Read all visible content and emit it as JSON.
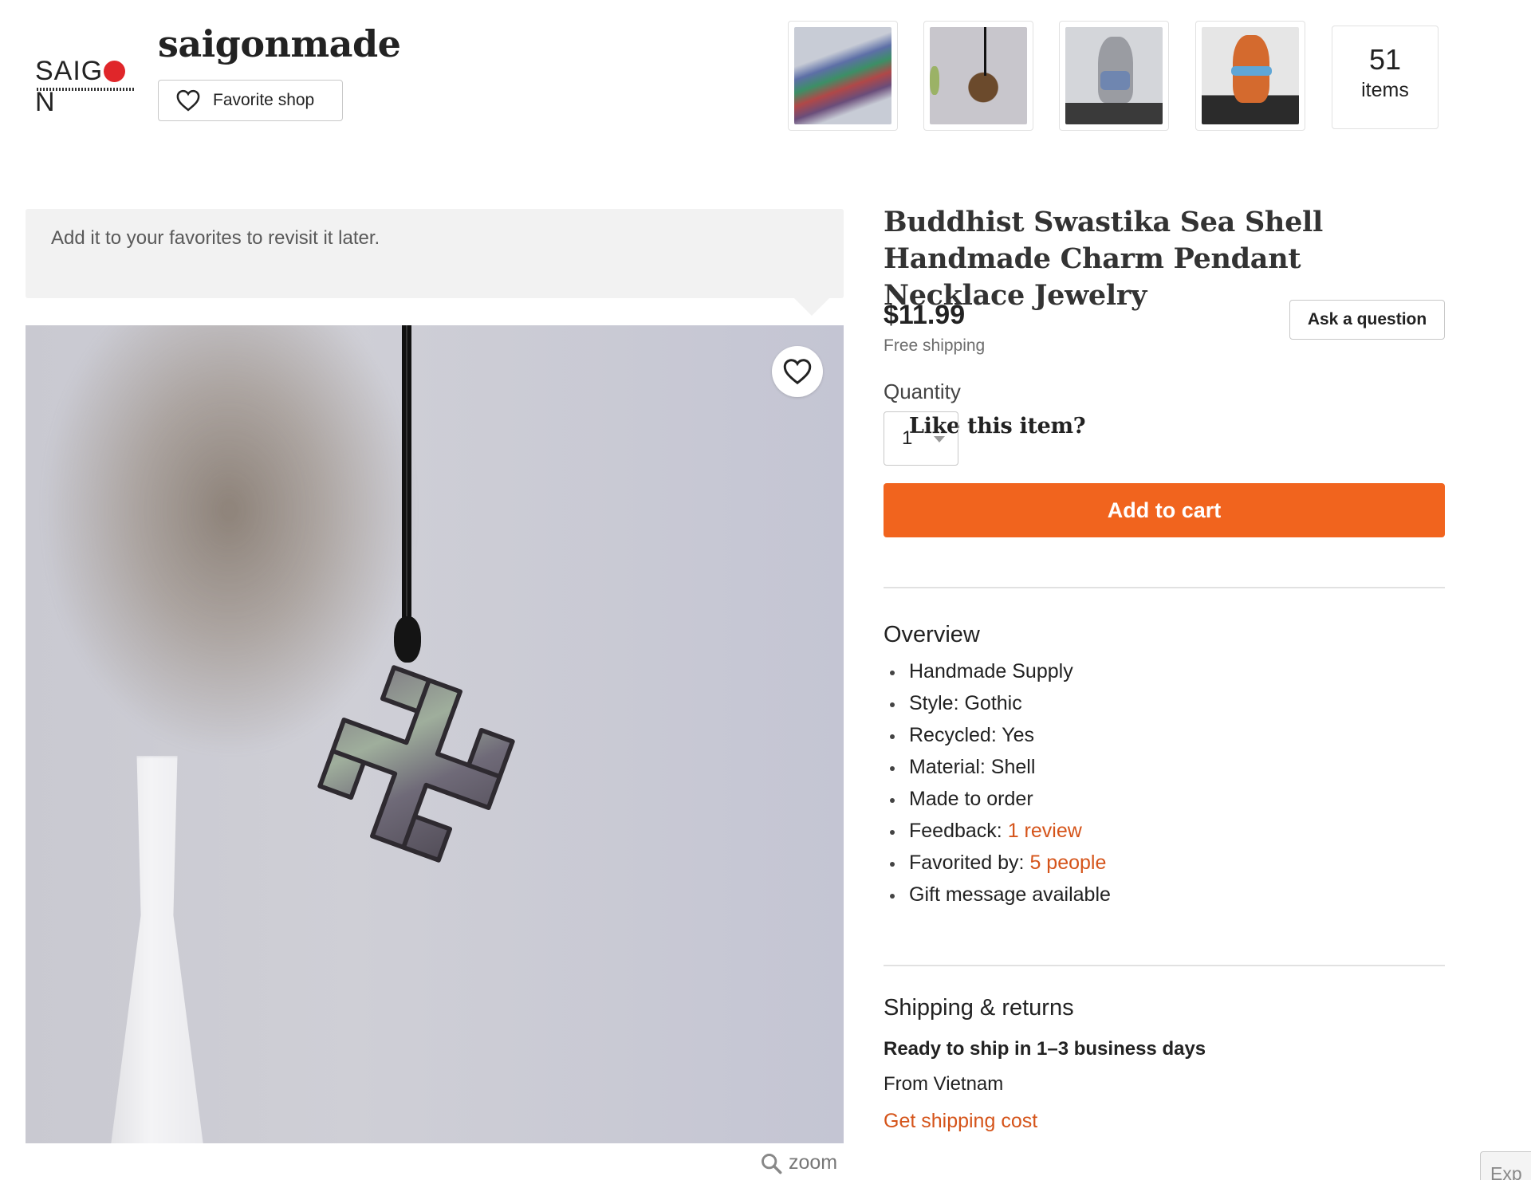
{
  "shop": {
    "logo_text_left": "SAIG",
    "logo_text_right": "N",
    "name": "saigonmade",
    "favorite_label": "Favorite shop",
    "items_count": "51",
    "items_label": "items"
  },
  "banner": {
    "title": "Like this item?",
    "subtitle": "Add it to your favorites to revisit it later."
  },
  "image": {
    "zoom_label": "zoom"
  },
  "product": {
    "title": "Buddhist Swastika Sea Shell Handmade Charm Pendant Necklace Jewelry",
    "price": "$11.99",
    "shipping_note": "Free shipping",
    "ask_label": "Ask a question",
    "quantity_label": "Quantity",
    "quantity_value": "1",
    "add_to_cart_label": "Add to cart"
  },
  "overview": {
    "heading": "Overview",
    "items": [
      {
        "text": "Handmade Supply"
      },
      {
        "text": "Style: Gothic"
      },
      {
        "text": "Recycled: Yes"
      },
      {
        "text": "Material: Shell"
      },
      {
        "text": "Made to order"
      },
      {
        "text": "Feedback: ",
        "link": "1 review"
      },
      {
        "text": "Favorited by: ",
        "link": "5 people"
      },
      {
        "text": "Gift message available"
      }
    ]
  },
  "shipping": {
    "heading": "Shipping & returns",
    "ready": "Ready to ship in 1–3 business days",
    "from": "From Vietnam",
    "cost_link": "Get shipping cost"
  },
  "expand_label": "Exp",
  "colors": {
    "accent": "#f1641e",
    "link": "#d5541a",
    "banner_bg": "#f2f2f2"
  }
}
